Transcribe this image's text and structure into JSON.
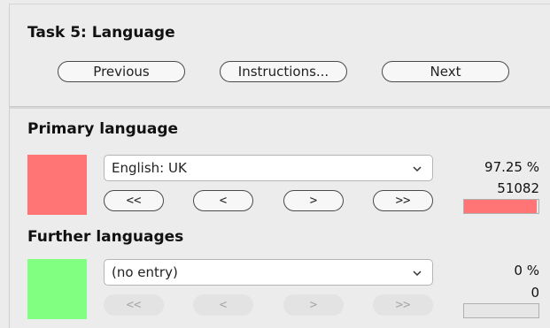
{
  "task": {
    "title": "Task 5: Language"
  },
  "nav": {
    "previous_label": "Previous",
    "instructions_label": "Instructions...",
    "next_label": "Next"
  },
  "primary": {
    "title": "Primary language",
    "color": "#ff7575",
    "selected": "English: UK",
    "percent": "97.25 %",
    "count": "51082",
    "progress": 0.9725,
    "buttons": [
      "<<",
      "<",
      ">",
      ">>"
    ]
  },
  "further": {
    "title": "Further languages",
    "color": "#80ff80",
    "selected": "(no entry)",
    "percent": "0 %",
    "count": "0",
    "progress": 0,
    "buttons": [
      "<<",
      "<",
      ">",
      ">>"
    ]
  }
}
